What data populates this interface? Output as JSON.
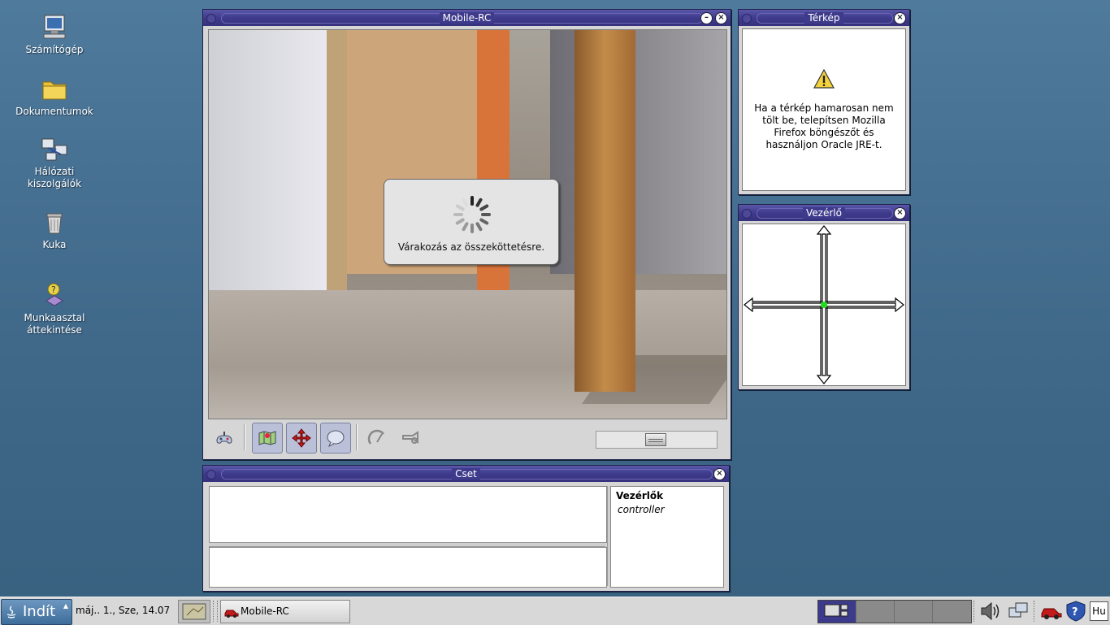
{
  "desktop": {
    "icons": [
      {
        "label": "Számítógép",
        "icon": "computer-icon"
      },
      {
        "label": "Dokumentumok",
        "icon": "folder-icon"
      },
      {
        "label": "Hálózati kiszolgálók",
        "icon": "network-servers-icon"
      },
      {
        "label": "Kuka",
        "icon": "trash-icon"
      },
      {
        "label": "Munkaasztal áttekintése",
        "icon": "desktop-overview-icon"
      }
    ]
  },
  "mobile_rc": {
    "title": "Mobile-RC",
    "loading_message": "Várakozás az összeköttetésre.",
    "toolbar": [
      "joystick-icon",
      "map-icon",
      "move-arrows-icon",
      "chat-bubble-icon",
      "speedometer-icon",
      "horn-icon"
    ],
    "slider_value": 0.5
  },
  "map_window": {
    "title": "Térkép",
    "message": "Ha a térkép hamarosan nem tölt be, telepítsen Mozilla Firefox böngészőt és használjon Oracle JRE-t."
  },
  "controller_window": {
    "title": "Vezérlő"
  },
  "chat_window": {
    "title": "Cset",
    "users_header": "Vezérlők",
    "users": [
      "controller"
    ]
  },
  "taskbar": {
    "start_label": "Indít",
    "clock": "máj.. 1., Sze, 14.07",
    "task_label": "Mobile-RC",
    "keyboard_layout": "Hu"
  },
  "colors": {
    "desktop": "#426b8d",
    "titlebar": "#3f3b8c",
    "controller_center": "#22dd22"
  }
}
